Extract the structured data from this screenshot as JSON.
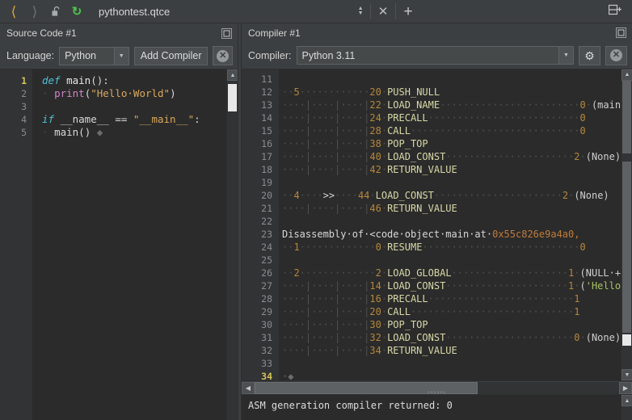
{
  "toolbar": {
    "back_icon": "chevron-left-icon",
    "forward_icon": "chevron-right-icon",
    "lock_icon": "unlocked-padlock-icon",
    "refresh_icon": "refresh-icon",
    "file_title": "pythontest.qtce",
    "spin_icon": "spinner-updown-icon",
    "close_icon": "close-icon",
    "add_icon": "plus-icon",
    "split_icon": "split-pane-add-icon",
    "colors": {
      "back_active": "#d8a93a",
      "forward_disabled": "#6e7173",
      "refresh_green": "#4fc24f"
    }
  },
  "source_panel": {
    "header_title": "Source Code #1",
    "maximize_icon": "maximize-panel-icon",
    "language_label": "Language:",
    "language_value": "Python",
    "add_compiler_label": "Add Compiler",
    "close_panel_icon": "close-circle-icon",
    "dropdown_icon": "chevron-down-icon",
    "gutter": [
      "1",
      "2",
      "3",
      "4",
      "5"
    ],
    "current_line": 1,
    "lines": [
      [
        {
          "t": "def ",
          "c": "kw"
        },
        {
          "t": "main",
          "c": "fn"
        },
        {
          "t": "():",
          "c": "op"
        }
      ],
      [
        {
          "t": "·",
          "c": "indent-guide"
        },
        {
          "t": " ",
          "c": "plain"
        },
        {
          "t": "print",
          "c": "builtin"
        },
        {
          "t": "(",
          "c": "op"
        },
        {
          "t": "\"Hello·World\"",
          "c": "str"
        },
        {
          "t": ")",
          "c": "op"
        }
      ],
      [],
      [
        {
          "t": "if ",
          "c": "kw"
        },
        {
          "t": "__name__",
          "c": "plain"
        },
        {
          "t": " == ",
          "c": "op"
        },
        {
          "t": "\"__main__\"",
          "c": "str"
        },
        {
          "t": ":",
          "c": "op"
        }
      ],
      [
        {
          "t": "·",
          "c": "indent-guide"
        },
        {
          "t": " ",
          "c": "plain"
        },
        {
          "t": "main",
          "c": "plain"
        },
        {
          "t": "()",
          "c": "op"
        },
        {
          "t": " ◆",
          "c": "caret-diamond"
        }
      ]
    ]
  },
  "compiler_panel": {
    "header_title": "Compiler #1",
    "maximize_icon": "maximize-panel-icon",
    "compiler_label": "Compiler:",
    "compiler_value": "Python 3.11",
    "dropdown_icon": "chevron-down-icon",
    "settings_icon": "gear-icon",
    "close_panel_icon": "close-circle-icon",
    "gutter": [
      "11",
      "12",
      "13",
      "14",
      "15",
      "16",
      "17",
      "18",
      "19",
      "20",
      "21",
      "22",
      "23",
      "24",
      "25",
      "26",
      "27",
      "28",
      "29",
      "30",
      "31",
      "32",
      "33",
      "34"
    ],
    "current_line": 34,
    "lines": [
      [],
      [
        {
          "t": "··",
          "c": "ws"
        },
        {
          "t": "5",
          "c": "num"
        },
        {
          "t": "············",
          "c": "ws"
        },
        {
          "t": "20",
          "c": "num"
        },
        {
          "t": "·",
          "c": "ws"
        },
        {
          "t": "PUSH_NULL",
          "c": "opc"
        }
      ],
      [
        {
          "t": "····|····|····|",
          "c": "ws"
        },
        {
          "t": "22",
          "c": "num"
        },
        {
          "t": "·",
          "c": "ws"
        },
        {
          "t": "LOAD_NAME",
          "c": "opc"
        },
        {
          "t": "························",
          "c": "ws"
        },
        {
          "t": "0",
          "c": "num"
        },
        {
          "t": "·",
          "c": "ws"
        },
        {
          "t": "(main)",
          "c": "arg"
        }
      ],
      [
        {
          "t": "····|····|····|",
          "c": "ws"
        },
        {
          "t": "24",
          "c": "num"
        },
        {
          "t": "·",
          "c": "ws"
        },
        {
          "t": "PRECALL",
          "c": "opc"
        },
        {
          "t": "··························",
          "c": "ws"
        },
        {
          "t": "0",
          "c": "num"
        }
      ],
      [
        {
          "t": "····|····|····|",
          "c": "ws"
        },
        {
          "t": "28",
          "c": "num"
        },
        {
          "t": "·",
          "c": "ws"
        },
        {
          "t": "CALL",
          "c": "opc"
        },
        {
          "t": "·····························",
          "c": "ws"
        },
        {
          "t": "0",
          "c": "num"
        }
      ],
      [
        {
          "t": "····|····|····|",
          "c": "ws"
        },
        {
          "t": "38",
          "c": "num"
        },
        {
          "t": "·",
          "c": "ws"
        },
        {
          "t": "POP_TOP",
          "c": "opc"
        }
      ],
      [
        {
          "t": "····|····|····|",
          "c": "ws"
        },
        {
          "t": "40",
          "c": "num"
        },
        {
          "t": "·",
          "c": "ws"
        },
        {
          "t": "LOAD_CONST",
          "c": "opc"
        },
        {
          "t": "······················",
          "c": "ws"
        },
        {
          "t": "2",
          "c": "num"
        },
        {
          "t": "·",
          "c": "ws"
        },
        {
          "t": "(None)",
          "c": "arg"
        }
      ],
      [
        {
          "t": "····|····|····|",
          "c": "ws"
        },
        {
          "t": "42",
          "c": "num"
        },
        {
          "t": "·",
          "c": "ws"
        },
        {
          "t": "RETURN_VALUE",
          "c": "opc"
        }
      ],
      [],
      [
        {
          "t": "··",
          "c": "ws"
        },
        {
          "t": "4",
          "c": "num"
        },
        {
          "t": "····",
          "c": "ws"
        },
        {
          "t": ">>",
          "c": "marker"
        },
        {
          "t": "····",
          "c": "ws"
        },
        {
          "t": "44",
          "c": "num"
        },
        {
          "t": "·",
          "c": "ws"
        },
        {
          "t": "LOAD_CONST",
          "c": "opc"
        },
        {
          "t": "······················",
          "c": "ws"
        },
        {
          "t": "2",
          "c": "num"
        },
        {
          "t": "·",
          "c": "ws"
        },
        {
          "t": "(None)",
          "c": "arg"
        }
      ],
      [
        {
          "t": "····|····|····|",
          "c": "ws"
        },
        {
          "t": "46",
          "c": "num"
        },
        {
          "t": "·",
          "c": "ws"
        },
        {
          "t": "RETURN_VALUE",
          "c": "opc"
        }
      ],
      [],
      [
        {
          "t": "Disassembly·of·<code·object·main·at·",
          "c": "txt"
        },
        {
          "t": "0x55c826e9a4a0,",
          "c": "hexaddr"
        }
      ],
      [
        {
          "t": "··",
          "c": "ws"
        },
        {
          "t": "1",
          "c": "num"
        },
        {
          "t": "·············",
          "c": "ws"
        },
        {
          "t": "0",
          "c": "num"
        },
        {
          "t": "·",
          "c": "ws"
        },
        {
          "t": "RESUME",
          "c": "opc"
        },
        {
          "t": "···························",
          "c": "ws"
        },
        {
          "t": "0",
          "c": "num"
        }
      ],
      [],
      [
        {
          "t": "··",
          "c": "ws"
        },
        {
          "t": "2",
          "c": "num"
        },
        {
          "t": "·············",
          "c": "ws"
        },
        {
          "t": "2",
          "c": "num"
        },
        {
          "t": "·",
          "c": "ws"
        },
        {
          "t": "LOAD_GLOBAL",
          "c": "opc"
        },
        {
          "t": "····················",
          "c": "ws"
        },
        {
          "t": "1",
          "c": "num"
        },
        {
          "t": "·",
          "c": "ws"
        },
        {
          "t": "(NULL·+·p",
          "c": "arg"
        }
      ],
      [
        {
          "t": "····|····|····|",
          "c": "ws"
        },
        {
          "t": "14",
          "c": "num"
        },
        {
          "t": "·",
          "c": "ws"
        },
        {
          "t": "LOAD_CONST",
          "c": "opc"
        },
        {
          "t": "·····················",
          "c": "ws"
        },
        {
          "t": "1",
          "c": "num"
        },
        {
          "t": "·",
          "c": "ws"
        },
        {
          "t": "(",
          "c": "arg"
        },
        {
          "t": "'Hello·W",
          "c": "strlit"
        }
      ],
      [
        {
          "t": "····|····|····|",
          "c": "ws"
        },
        {
          "t": "16",
          "c": "num"
        },
        {
          "t": "·",
          "c": "ws"
        },
        {
          "t": "PRECALL",
          "c": "opc"
        },
        {
          "t": "·························",
          "c": "ws"
        },
        {
          "t": "1",
          "c": "num"
        }
      ],
      [
        {
          "t": "····|····|····|",
          "c": "ws"
        },
        {
          "t": "20",
          "c": "num"
        },
        {
          "t": "·",
          "c": "ws"
        },
        {
          "t": "CALL",
          "c": "opc"
        },
        {
          "t": "····························",
          "c": "ws"
        },
        {
          "t": "1",
          "c": "num"
        }
      ],
      [
        {
          "t": "····|····|····|",
          "c": "ws"
        },
        {
          "t": "30",
          "c": "num"
        },
        {
          "t": "·",
          "c": "ws"
        },
        {
          "t": "POP_TOP",
          "c": "opc"
        }
      ],
      [
        {
          "t": "····|····|····|",
          "c": "ws"
        },
        {
          "t": "32",
          "c": "num"
        },
        {
          "t": "·",
          "c": "ws"
        },
        {
          "t": "LOAD_CONST",
          "c": "opc"
        },
        {
          "t": "······················",
          "c": "ws"
        },
        {
          "t": "0",
          "c": "num"
        },
        {
          "t": "·",
          "c": "ws"
        },
        {
          "t": "(None)",
          "c": "arg"
        }
      ],
      [
        {
          "t": "····|····|····|",
          "c": "ws"
        },
        {
          "t": "34",
          "c": "num"
        },
        {
          "t": "·",
          "c": "ws"
        },
        {
          "t": "RETURN_VALUE",
          "c": "opc"
        }
      ],
      [],
      [
        {
          "t": "·◆",
          "c": "caret-diamond"
        }
      ]
    ]
  },
  "status": {
    "text": "ASM generation compiler returned: 0"
  },
  "scrollbars": {
    "up_arrow": "scroll-up-arrow-icon",
    "down_arrow": "scroll-down-arrow-icon",
    "left_arrow": "scroll-left-arrow-icon",
    "right_arrow": "scroll-right-arrow-icon"
  }
}
